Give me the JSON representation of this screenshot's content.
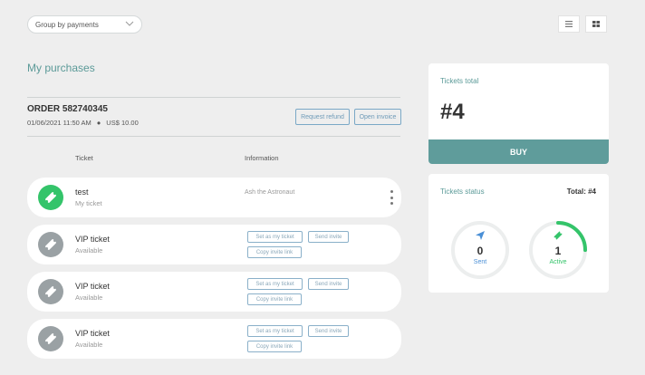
{
  "toolbar": {
    "group_select_value": "Group by payments",
    "list_view_icon": "list-icon",
    "grid_view_icon": "grid-icon"
  },
  "page": {
    "title": "My purchases"
  },
  "order": {
    "title": "ORDER 582740345",
    "date": "01/06/2021 11:50 AM",
    "amount": "US$ 10.00",
    "request_refund_label": "Request refund",
    "open_invoice_label": "Open invoice"
  },
  "columns": {
    "ticket": "Ticket",
    "information": "Information"
  },
  "tickets": [
    {
      "name": "test",
      "status": "My ticket",
      "info": "Ash the Astronaut",
      "icon": "ticket-icon",
      "color": "#34c46a"
    },
    {
      "name": "VIP ticket",
      "status": "Available",
      "set_label": "Set as my ticket",
      "send_label": "Send invite",
      "copy_label": "Copy invite link",
      "icon": "ticket-icon",
      "color": "#9aa1a4"
    },
    {
      "name": "VIP ticket",
      "status": "Available",
      "set_label": "Set as my ticket",
      "send_label": "Send invite",
      "copy_label": "Copy invite link",
      "icon": "ticket-icon",
      "color": "#9aa1a4"
    },
    {
      "name": "VIP ticket",
      "status": "Available",
      "set_label": "Set as my ticket",
      "send_label": "Send invite",
      "copy_label": "Copy invite link",
      "icon": "ticket-icon",
      "color": "#9aa1a4"
    }
  ],
  "tickets_total": {
    "label": "Tickets total",
    "value": "#4",
    "buy_label": "BUY"
  },
  "tickets_status": {
    "label": "Tickets status",
    "total": "Total: #4",
    "sent": {
      "value": "0",
      "label": "Sent",
      "color": "#4a8fd6",
      "icon": "paper-plane-icon"
    },
    "active": {
      "value": "1",
      "label": "Active",
      "color": "#34c46a",
      "icon": "ticket-icon",
      "fraction": 0.25
    }
  },
  "colors": {
    "accent": "#5b9a98",
    "buy": "#5f9c9b",
    "active": "#34c46a",
    "sent": "#4a8fd6",
    "inactive": "#9aa1a4"
  }
}
